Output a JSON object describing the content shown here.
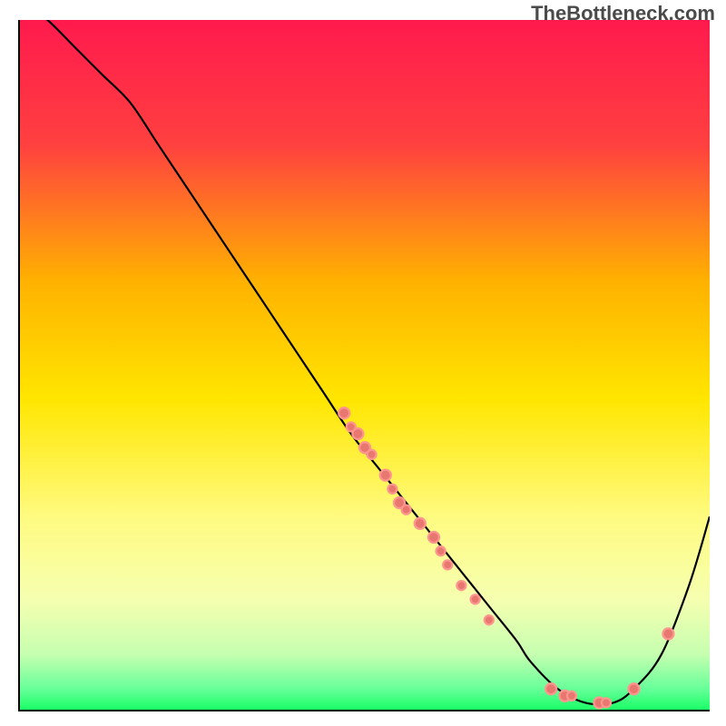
{
  "branding": {
    "watermark": "TheBottleneck.com"
  },
  "chart_data": {
    "type": "line",
    "title": "",
    "xlabel": "",
    "ylabel": "",
    "xlim": [
      0,
      100
    ],
    "ylim": [
      0,
      100
    ],
    "grid": false,
    "legend": false,
    "background": {
      "gradient_stops": [
        {
          "pos": 0.0,
          "color": "#ff1a4d"
        },
        {
          "pos": 0.18,
          "color": "#ff4040"
        },
        {
          "pos": 0.38,
          "color": "#ffb200"
        },
        {
          "pos": 0.55,
          "color": "#ffe600"
        },
        {
          "pos": 0.72,
          "color": "#fffb80"
        },
        {
          "pos": 0.84,
          "color": "#f6ffb0"
        },
        {
          "pos": 0.92,
          "color": "#c6ffb0"
        },
        {
          "pos": 0.97,
          "color": "#66ff99"
        },
        {
          "pos": 1.0,
          "color": "#1aff66"
        }
      ]
    },
    "series": [
      {
        "name": "curve",
        "x": [
          0,
          4,
          8,
          12,
          16,
          20,
          24,
          28,
          32,
          36,
          40,
          44,
          48,
          52,
          56,
          60,
          64,
          68,
          72,
          74,
          78,
          82,
          86,
          89,
          93,
          97,
          100
        ],
        "y": [
          103,
          100,
          96,
          92,
          88,
          82,
          76,
          70,
          64,
          58,
          52,
          46,
          40,
          35,
          30,
          25,
          20,
          15,
          10,
          7,
          3,
          1,
          1,
          3,
          8,
          18,
          28
        ]
      }
    ],
    "scatter_points": {
      "name": "markers",
      "points": [
        {
          "x": 47,
          "y": 43,
          "r": 6
        },
        {
          "x": 48,
          "y": 41,
          "r": 5
        },
        {
          "x": 49,
          "y": 40,
          "r": 6
        },
        {
          "x": 50,
          "y": 38,
          "r": 6
        },
        {
          "x": 51,
          "y": 37,
          "r": 5
        },
        {
          "x": 53,
          "y": 34,
          "r": 6
        },
        {
          "x": 54,
          "y": 32,
          "r": 5
        },
        {
          "x": 55,
          "y": 30,
          "r": 6
        },
        {
          "x": 56,
          "y": 29,
          "r": 5
        },
        {
          "x": 58,
          "y": 27,
          "r": 6
        },
        {
          "x": 60,
          "y": 25,
          "r": 6
        },
        {
          "x": 61,
          "y": 23,
          "r": 5
        },
        {
          "x": 62,
          "y": 21,
          "r": 5
        },
        {
          "x": 64,
          "y": 18,
          "r": 5
        },
        {
          "x": 66,
          "y": 16,
          "r": 5
        },
        {
          "x": 68,
          "y": 13,
          "r": 5
        },
        {
          "x": 77,
          "y": 3,
          "r": 6
        },
        {
          "x": 79,
          "y": 2,
          "r": 6
        },
        {
          "x": 80,
          "y": 2,
          "r": 5
        },
        {
          "x": 84,
          "y": 1,
          "r": 6
        },
        {
          "x": 85,
          "y": 1,
          "r": 5
        },
        {
          "x": 89,
          "y": 3,
          "r": 6
        },
        {
          "x": 94,
          "y": 11,
          "r": 6
        }
      ]
    }
  }
}
